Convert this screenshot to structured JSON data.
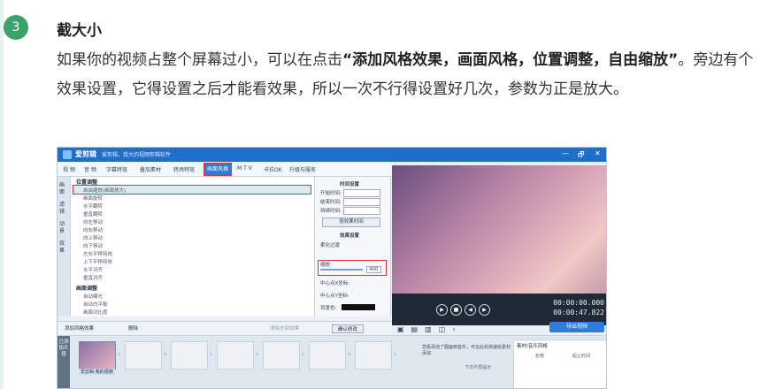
{
  "step": {
    "number": "3",
    "title": "截大小"
  },
  "paragraph": {
    "p1": "如果你的视频占整个屏幕过小，可以在点击",
    "bold": "“添加风格效果，画面风格，位置调整，自由缩放”",
    "p2": "。旁边有个效果设置，它得设置之后才能看效果，所以一次不行得设置好几次，参数为正是放大。"
  },
  "screenshot": {
    "app_name": "爱剪辑",
    "slogan": "爱剪辑，我大的视频剪辑软件",
    "window_controls": [
      "—",
      "🗗",
      "✕"
    ],
    "tabs": [
      "视 频",
      "音 频",
      "字幕特效",
      "叠加素材",
      "转场特效",
      "画面风格",
      "M T V",
      "卡拉OK",
      "升级与服务"
    ],
    "active_tab_index": 5,
    "side_tabs": [
      "画面",
      "滤镜",
      "动景",
      "效果"
    ],
    "list": {
      "group1": "位置调整",
      "items1": [
        "自由缩放(画面放大)",
        "画面旋转",
        "水平翻转",
        "垂直翻转",
        "向左移动",
        "向右移动",
        "向上移动",
        "向下移动",
        "左右平移特效",
        "上下平移特效",
        "水平对齐",
        "垂直对齐"
      ],
      "group2": "画面调整",
      "items2": [
        "自动曝光",
        "自动白平衡",
        "画面对比度"
      ]
    },
    "settings": {
      "section1": "时间设置",
      "start": "开始时间:",
      "end": "结束时间:",
      "duration": "持续时间:",
      "time_value": "00:00:00.000",
      "apply_time": "按效果时间",
      "section2": "效果设置",
      "smooth": "柔化过渡",
      "zoom": "缩放:",
      "zoom_value": "400",
      "cx": "中心点X坐标:",
      "cy": "中心点Y坐标:",
      "bg": "背景色:",
      "confirm": "确认修改"
    },
    "bottom": {
      "add": "添加风格效果",
      "delete": "删除",
      "delete_all": "清除全部效果"
    },
    "player": {
      "time_current": "00:00:00.000",
      "time_total": "00:00:47.822",
      "export": "导出视频"
    },
    "timeline": {
      "side_label": "已添加片段",
      "clip_caption": "爱剪辑-我的视频",
      "hint": "您看添加了图画到音乐，可在此处快速给素材添加",
      "checkbox": "下次不再提示",
      "panel_title": "素材/音乐风格",
      "col1": "名称",
      "col2": "起止时间"
    }
  }
}
